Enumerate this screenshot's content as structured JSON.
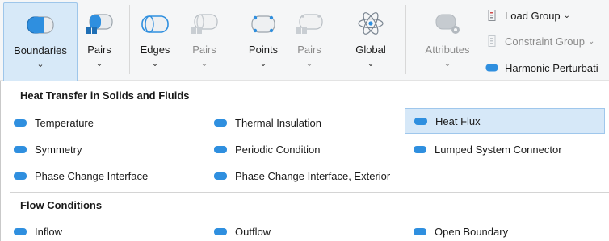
{
  "ribbon": {
    "buttons": [
      {
        "label": "Boundaries",
        "chevron": "⌄",
        "icon": "boundaries-icon"
      },
      {
        "label": "Pairs",
        "chevron": "⌄",
        "icon": "pairs-icon"
      },
      {
        "label": "Edges",
        "chevron": "⌄",
        "icon": "edges-icon"
      },
      {
        "label": "Pairs",
        "chevron": "⌄",
        "icon": "edge-pairs-icon"
      },
      {
        "label": "Points",
        "chevron": "⌄",
        "icon": "points-icon"
      },
      {
        "label": "Pairs",
        "chevron": "⌄",
        "icon": "point-pairs-icon"
      },
      {
        "label": "Global",
        "chevron": "⌄",
        "icon": "global-atom-icon"
      },
      {
        "label": "Attributes",
        "chevron": "⌄",
        "icon": "attributes-icon"
      }
    ],
    "small_buttons": [
      {
        "label": "Load Group",
        "caret": "⌄",
        "icon": "load-group-icon"
      },
      {
        "label": "Constraint Group",
        "caret": "⌄",
        "icon": "constraint-group-icon"
      },
      {
        "label": "Harmonic Perturbati",
        "icon": "harmonic-perturbation-icon"
      }
    ],
    "colors": {
      "accent": "#2f8fdf",
      "active_bg": "#d7e9f8"
    }
  },
  "menu": {
    "sections": [
      {
        "title": "Heat Transfer in Solids and Fluids",
        "items": [
          "Temperature",
          "Thermal Insulation",
          "Heat Flux",
          "Symmetry",
          "Periodic Condition",
          "Lumped System Connector",
          "Phase Change Interface",
          "Phase Change Interface, Exterior"
        ],
        "selected": "Heat Flux"
      },
      {
        "title": "Flow Conditions",
        "items": [
          "Inflow",
          "Outflow",
          "Open Boundary"
        ]
      }
    ]
  }
}
